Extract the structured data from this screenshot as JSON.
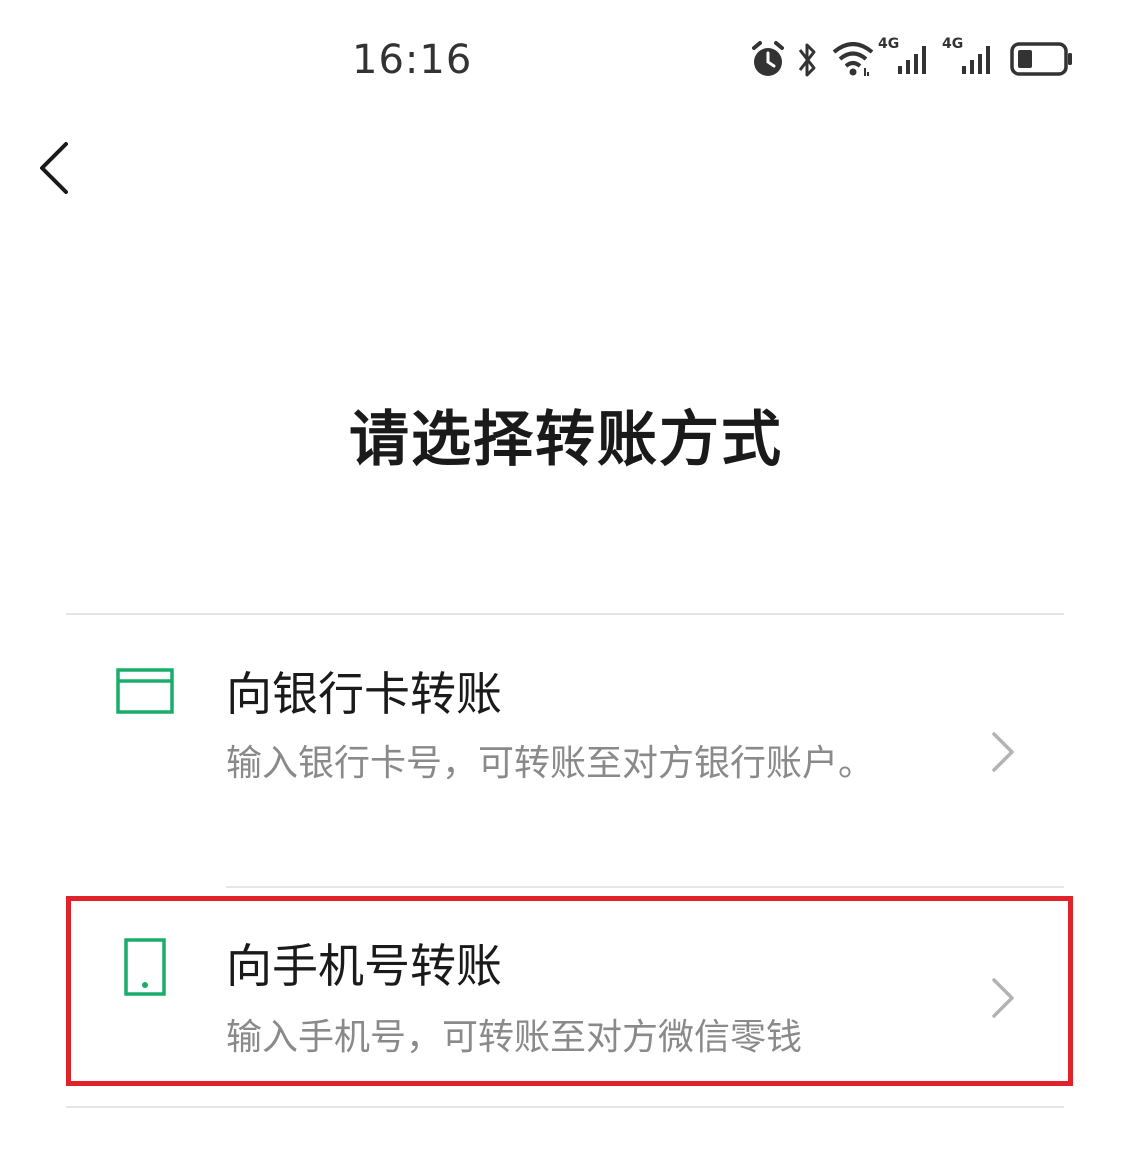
{
  "status_bar": {
    "time": "16:16",
    "icons": [
      "alarm-icon",
      "bluetooth-icon",
      "wifi-icon",
      "signal-4g-icon",
      "signal-4g-icon",
      "battery-icon"
    ],
    "network_label_1": "4G",
    "network_label_2": "4G"
  },
  "header": {
    "back_icon": "chevron-left-icon"
  },
  "title": "请选择转账方式",
  "options": [
    {
      "icon": "bank-card-icon",
      "title": "向银行卡转账",
      "description": "输入银行卡号，可转账至对方银行账户。"
    },
    {
      "icon": "mobile-phone-icon",
      "title": "向手机号转账",
      "description": "输入手机号，可转账至对方微信零钱"
    }
  ],
  "colors": {
    "accent_green": "#1aad6a",
    "highlight_red": "#e0222a",
    "secondary_text": "#8a8a8a",
    "divider": "#e5e5e5"
  }
}
